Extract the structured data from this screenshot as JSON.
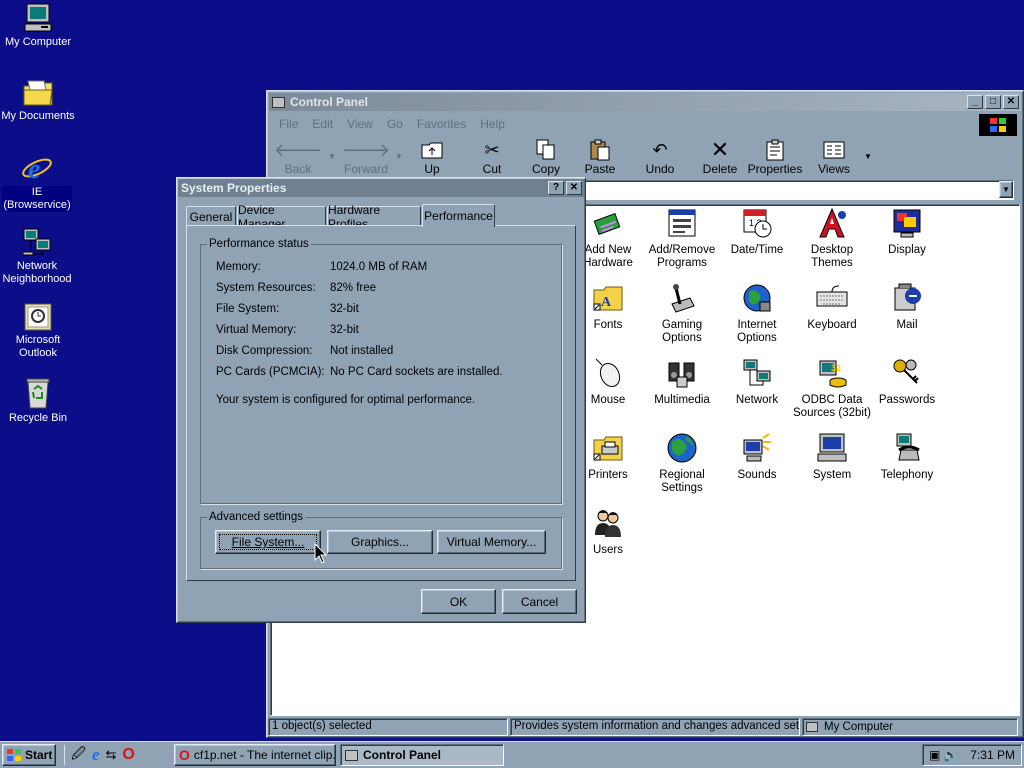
{
  "desktop": {
    "icons": [
      {
        "label": "My Computer",
        "icon": "my-computer-icon"
      },
      {
        "label": "My Documents",
        "icon": "folder-icon"
      },
      {
        "label": "IE\n(Browservice)",
        "icon": "internet-explorer-icon"
      },
      {
        "label": "Network\nNeighborhood",
        "icon": "network-icon"
      },
      {
        "label": "Microsoft\nOutlook",
        "icon": "outlook-icon"
      },
      {
        "label": "Recycle Bin",
        "icon": "recycle-bin-icon"
      }
    ]
  },
  "control_panel": {
    "title": "Control Panel",
    "menu": [
      "File",
      "Edit",
      "View",
      "Go",
      "Favorites",
      "Help"
    ],
    "toolbar": {
      "back": "Back",
      "forward": "Forward",
      "up": "Up",
      "cut": "Cut",
      "copy": "Copy",
      "paste": "Paste",
      "undo": "Undo",
      "delete": "Delete",
      "properties": "Properties",
      "views": "Views"
    },
    "items": [
      {
        "label": "Add New\nHardware"
      },
      {
        "label": "Add/Remove\nPrograms"
      },
      {
        "label": "Date/Time"
      },
      {
        "label": "Desktop\nThemes"
      },
      {
        "label": "Display"
      },
      {
        "label": "Fonts"
      },
      {
        "label": "Gaming\nOptions"
      },
      {
        "label": "Internet\nOptions"
      },
      {
        "label": "Keyboard"
      },
      {
        "label": "Mail"
      },
      {
        "label": "Mouse"
      },
      {
        "label": "Multimedia"
      },
      {
        "label": "Network"
      },
      {
        "label": "ODBC Data\nSources (32bit)"
      },
      {
        "label": "Passwords"
      },
      {
        "label": "Printers"
      },
      {
        "label": "Regional\nSettings"
      },
      {
        "label": "Sounds"
      },
      {
        "label": "System"
      },
      {
        "label": "Telephony"
      },
      {
        "label": "Users"
      }
    ],
    "status": {
      "selected": "1 object(s) selected",
      "description": "Provides system information and changes advanced settings",
      "location": "My Computer"
    }
  },
  "system_properties": {
    "title": "System Properties",
    "tabs": [
      "General",
      "Device Manager",
      "Hardware Profiles",
      "Performance"
    ],
    "active_tab": "Performance",
    "status_group": "Performance status",
    "rows": [
      {
        "k": "Memory:",
        "v": "1024.0 MB of RAM"
      },
      {
        "k": "System Resources:",
        "v": "82% free"
      },
      {
        "k": "File System:",
        "v": "32-bit"
      },
      {
        "k": "Virtual Memory:",
        "v": "32-bit"
      },
      {
        "k": "Disk Compression:",
        "v": "Not installed"
      },
      {
        "k": "PC Cards (PCMCIA):",
        "v": "No PC Card sockets are installed."
      }
    ],
    "message": "Your system is configured for optimal performance.",
    "advanced_group": "Advanced settings",
    "buttons": {
      "file_system": "File System...",
      "graphics": "Graphics...",
      "virtual_memory": "Virtual Memory..."
    },
    "ok": "OK",
    "cancel": "Cancel"
  },
  "taskbar": {
    "start": "Start",
    "tasks": [
      "cf1p.net - The internet clip...",
      "Control Panel"
    ],
    "clock": "7:31 PM"
  }
}
